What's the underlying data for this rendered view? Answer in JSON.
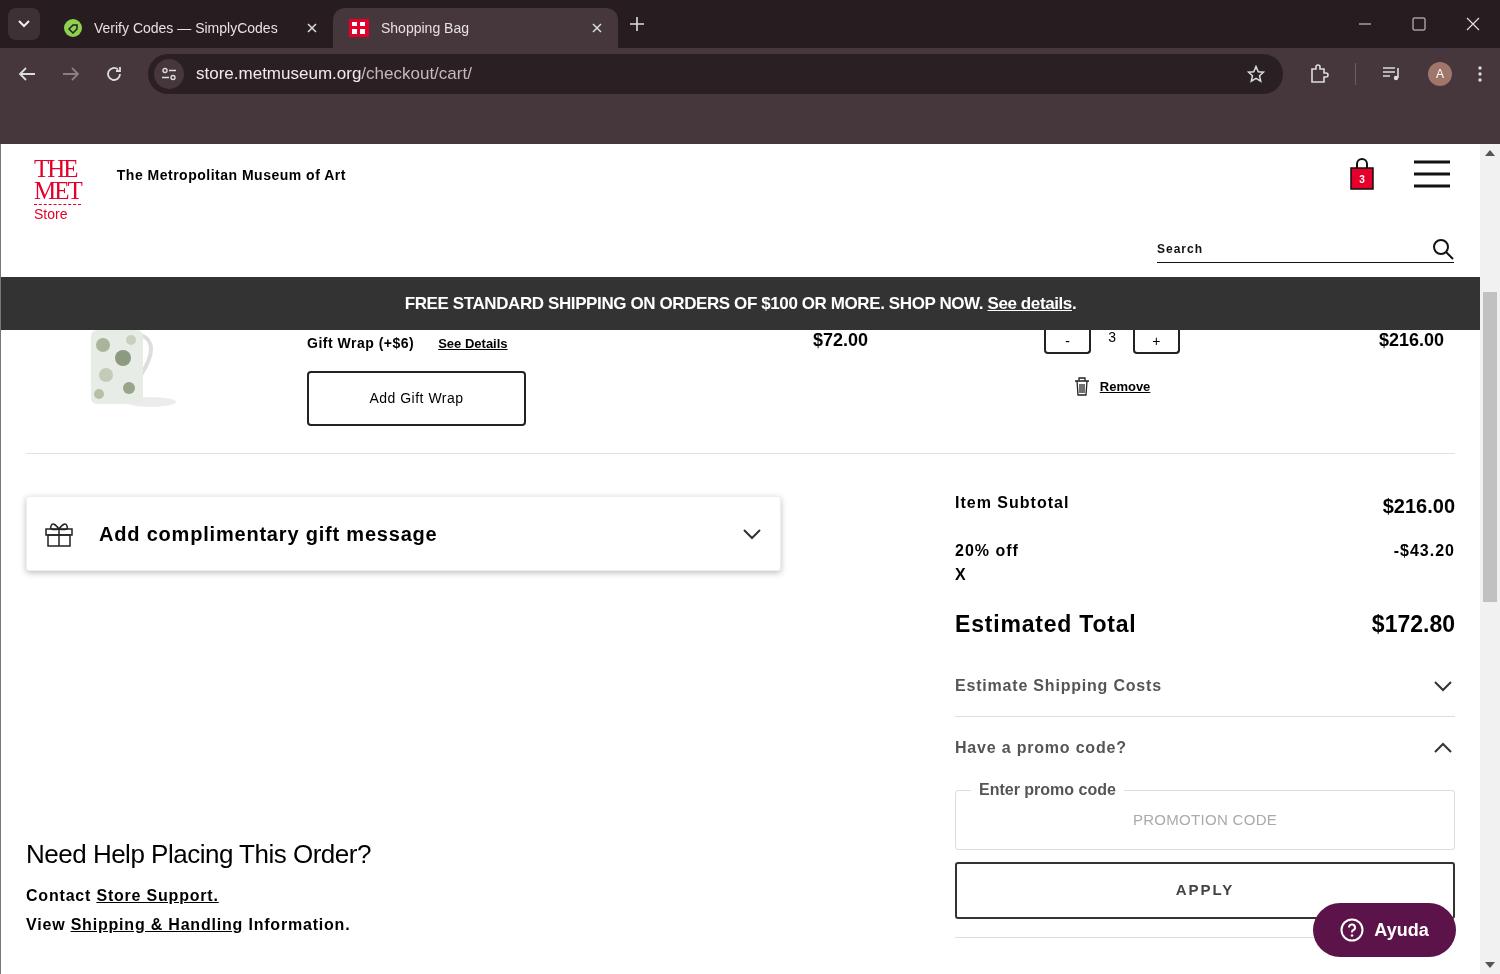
{
  "browser": {
    "tabs": [
      {
        "title": "Verify Codes — SimplyCodes",
        "selected": false,
        "kind": "simplycodes"
      },
      {
        "title": "Shopping Bag",
        "selected": true,
        "kind": "met"
      }
    ],
    "url_host": "store.metmuseum.org",
    "url_path": "/checkout/cart/",
    "avatar": "A"
  },
  "header": {
    "logo": [
      "THE",
      "MET",
      "Store"
    ],
    "museum_name": "The Metropolitan Museum of Art",
    "cart_count": "3",
    "search": {
      "placeholder": "Search"
    }
  },
  "banner": {
    "text": "FREE STANDARD SHIPPING ON ORDERS OF $100 OR MORE. SHOP NOW.",
    "link": "See details",
    "end": "."
  },
  "cart_item": {
    "gift_wrap_label": "Gift Wrap (+$6)",
    "see_details": "See Details",
    "add_gift_wrap": "Add Gift Wrap",
    "price": "$72.00",
    "minus": "-",
    "quantity": "3",
    "plus": "+",
    "total": "$216.00",
    "remove": "Remove"
  },
  "gift_message": {
    "label": "Add complimentary gift message",
    "expanded": false
  },
  "help": {
    "heading": "Need Help Placing This Order?",
    "lines": [
      [
        {
          "text": "Contact ",
          "link": false
        },
        {
          "text": "Store Support.",
          "link": true
        }
      ],
      [
        {
          "text": "View ",
          "link": false
        },
        {
          "text": "Shipping & Handling",
          "link": true
        },
        {
          "text": " Information.",
          "link": false
        }
      ]
    ]
  },
  "summary": {
    "subtotal_label": "Item Subtotal",
    "subtotal": "$216.00",
    "discount_label": "20% off",
    "discount_remove": "X",
    "discount": "-$43.20",
    "total_label": "Estimated Total",
    "total": "$172.80",
    "accordions": [
      {
        "label": "Estimate Shipping Costs",
        "expanded": false
      },
      {
        "label": "Have a promo code?",
        "expanded": true
      }
    ],
    "promo": {
      "label": "Enter promo code",
      "placeholder": "PROMOTION CODE",
      "apply": "APPLY"
    }
  },
  "chat": {
    "label": "Ayuda"
  }
}
